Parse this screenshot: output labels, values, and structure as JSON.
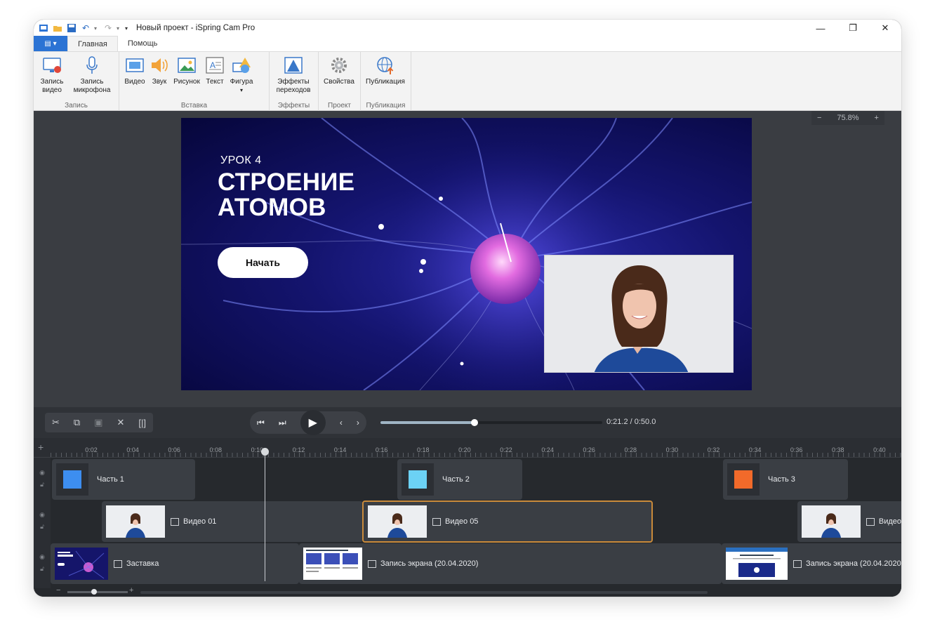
{
  "window": {
    "title": "Новый проект - iSpring Cam Pro",
    "min": "—",
    "restore": "❐",
    "close": "✕"
  },
  "quick_access": [
    "undo",
    "redo"
  ],
  "ribbon_tabs": {
    "file": "▤ ▾",
    "home": "Главная",
    "help": "Помощь"
  },
  "ribbon": {
    "record_video": "Запись видео",
    "record_mic": "Запись микрофона",
    "record_group": "Запись",
    "video": "Видео",
    "sound": "Звук",
    "picture": "Рисунок",
    "text": "Текст",
    "shape": "Фигура",
    "insert_group": "Вставка",
    "transitions": "Эффекты переходов",
    "effects_group": "Эффекты",
    "properties": "Свойства",
    "project_group": "Проект",
    "publish": "Публикация",
    "publish_group": "Публикация"
  },
  "zoom": {
    "minus": "−",
    "value": "75.8%",
    "plus": "+"
  },
  "slide": {
    "lesson": "УРОК 4",
    "title_line1": "СТРОЕНИЕ",
    "title_line2": "АТОМОВ",
    "start_button": "Начать"
  },
  "player": {
    "time": "0:21.2 / 0:50.0",
    "progress_fraction": 0.424
  },
  "ruler_ticks": [
    "0:02",
    "0:04",
    "0:06",
    "0:08",
    "0:10",
    "0:12",
    "0:14",
    "0:16",
    "0:18",
    "0:20",
    "0:22",
    "0:24",
    "0:26",
    "0:28",
    "0:30",
    "0:32",
    "0:34",
    "0:36",
    "0:38",
    "0:40"
  ],
  "tracks": {
    "track1": [
      {
        "label": "Часть 1",
        "color": "#3d8ef0"
      },
      {
        "label": "Часть 2",
        "color": "#6cd2f5"
      },
      {
        "label": "Часть 3",
        "color": "#f26a2a"
      }
    ],
    "track2": [
      {
        "label": "Видео 01"
      },
      {
        "label": "Видео 05"
      },
      {
        "label": "Видео"
      }
    ],
    "track3": [
      {
        "label": "Заставка"
      },
      {
        "label": "Запись экрана (20.04.2020)"
      },
      {
        "label": "Запись экрана (20.04.2020"
      }
    ]
  },
  "bottom": {
    "minus": "−",
    "plus": "+"
  },
  "colors": {
    "accent_blue": "#2b73d4",
    "selection_orange": "#c98a3a"
  }
}
